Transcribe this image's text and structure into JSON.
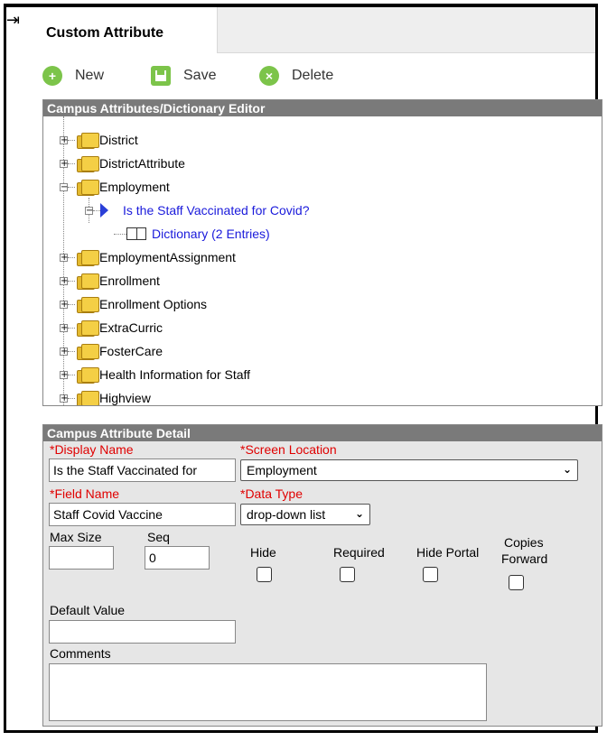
{
  "tab": {
    "title": "Custom Attribute"
  },
  "toolbar": {
    "new_label": "New",
    "save_label": "Save",
    "delete_label": "Delete"
  },
  "tree_panel": {
    "title": "Campus Attributes/Dictionary Editor",
    "nodes": [
      {
        "label": "District"
      },
      {
        "label": "DistrictAttribute"
      },
      {
        "label": "Employment"
      },
      {
        "label": "Is the Staff Vaccinated for Covid?"
      },
      {
        "label": "Dictionary (2 Entries)"
      },
      {
        "label": "EmploymentAssignment"
      },
      {
        "label": "Enrollment"
      },
      {
        "label": "Enrollment Options"
      },
      {
        "label": "ExtraCurric"
      },
      {
        "label": "FosterCare"
      },
      {
        "label": "Health Information for Staff"
      },
      {
        "label": "Highview"
      }
    ]
  },
  "detail_panel": {
    "title": "Campus Attribute Detail",
    "display_name_label": "*Display Name",
    "display_name_value": "Is the Staff Vaccinated for",
    "screen_location_label": "*Screen Location",
    "screen_location_value": "Employment",
    "field_name_label": "*Field Name",
    "field_name_value": "Staff Covid Vaccine",
    "data_type_label": "*Data Type",
    "data_type_value": "drop-down list",
    "max_size_label": "Max Size",
    "max_size_value": "",
    "seq_label": "Seq",
    "seq_value": "0",
    "hide_label": "Hide",
    "required_label": "Required",
    "hide_portal_label": "Hide Portal",
    "copies_forward_label_1": "Copies",
    "copies_forward_label_2": "Forward",
    "default_value_label": "Default Value",
    "default_value_value": "",
    "comments_label": "Comments",
    "comments_value": ""
  }
}
